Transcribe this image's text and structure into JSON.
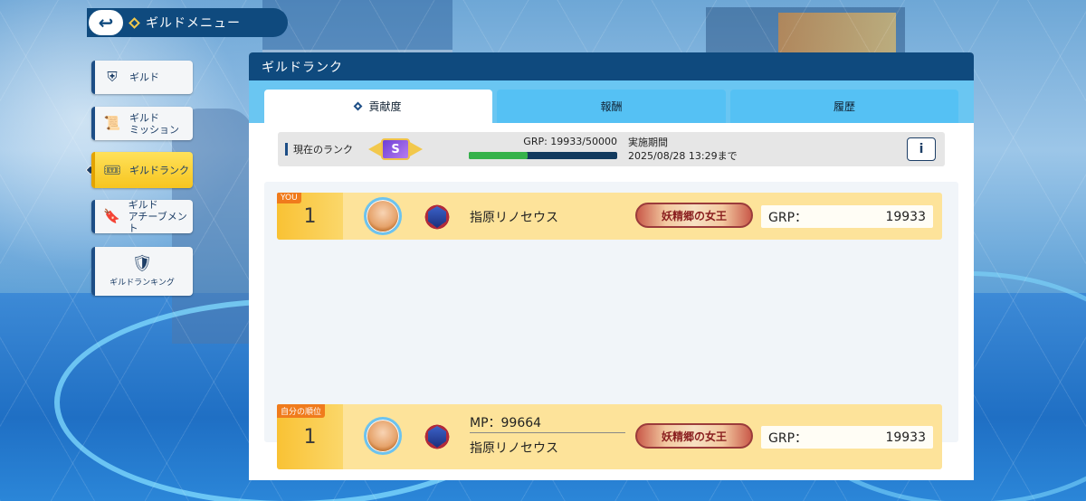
{
  "header": {
    "title": "ギルドメニュー",
    "back_icon": "back-arrow-icon"
  },
  "sidebar": {
    "items": [
      {
        "label": "ギルド",
        "icon": "guild-shield-icon"
      },
      {
        "label_line1": "ギルド",
        "label_line2": "ミッション",
        "icon": "scroll-icon"
      },
      {
        "label": "ギルドランク",
        "icon": "rank-ticket-icon",
        "active": true
      },
      {
        "label_line1": "ギルド",
        "label_line2": "アチーブメント",
        "icon": "achievement-banner-icon"
      },
      {
        "label": "ギルドランキング",
        "icon": "laurel-shield-icon"
      }
    ]
  },
  "panel": {
    "title": "ギルドランク",
    "tabs": [
      {
        "label": "貢献度",
        "active": true
      },
      {
        "label": "報酬"
      },
      {
        "label": "履歴"
      }
    ],
    "rank_info": {
      "label": "現在のランク",
      "rank": "S",
      "grp_text": "GRP: 19933/50000",
      "grp_progress": 0.39866,
      "period_label": "実施期間",
      "period_value": "2025/08/28 13:29まで",
      "info_button": "i"
    },
    "ranking": [
      {
        "tag": "YOU",
        "rank": "1",
        "name": "指原リノセウス",
        "title_banner": "妖精郷の女王",
        "grp_label": "GRP：",
        "grp_value": "19933"
      }
    ],
    "my_rank": {
      "tag": "自分の順位",
      "rank": "1",
      "mp": "MP：99664",
      "name": "指原リノセウス",
      "title_banner": "妖精郷の女王",
      "grp_label": "GRP：",
      "grp_value": "19933"
    }
  },
  "colors": {
    "header_bg": "#0f4a7e",
    "active_side": "#f7c51f",
    "tab_bg": "#55c1f4",
    "row_bg": "#fde39a",
    "progress_fill": "#35b24a"
  }
}
